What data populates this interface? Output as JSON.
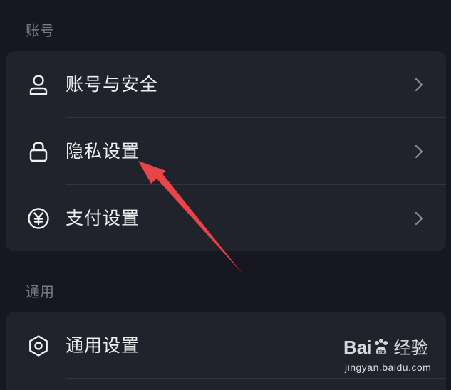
{
  "sections": [
    {
      "header": "账号",
      "items": [
        {
          "label": "账号与安全",
          "icon": "user-icon"
        },
        {
          "label": "隐私设置",
          "icon": "lock-icon"
        },
        {
          "label": "支付设置",
          "icon": "yuan-coin-icon"
        }
      ]
    },
    {
      "header": "通用",
      "items": [
        {
          "label": "通用设置",
          "icon": "gear-icon"
        }
      ]
    }
  ],
  "watermark": {
    "logo_prefix": "Bai",
    "logo_suffix": "经验",
    "url": "jingyan.baidu.com"
  },
  "colors": {
    "background": "#161722",
    "card": "#20222c",
    "divider": "#31333f",
    "header_text": "#7a7c86",
    "annotation_arrow": "#e8454a"
  }
}
